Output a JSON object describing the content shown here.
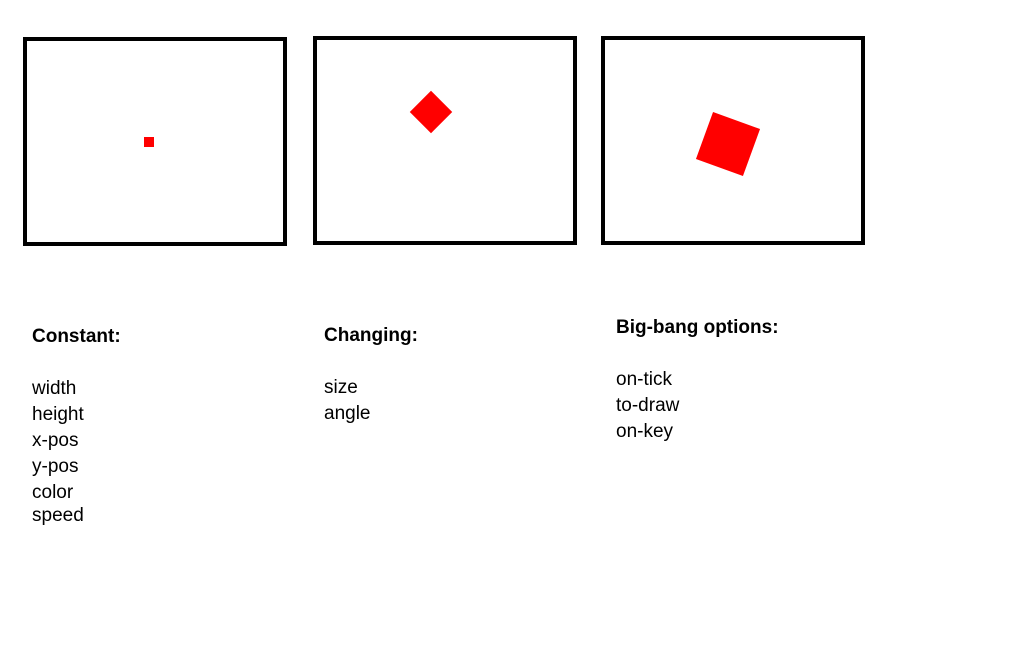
{
  "frames": [
    {
      "shape_color": "#ff0000",
      "rotation_deg": 0
    },
    {
      "shape_color": "#ff0000",
      "rotation_deg": 45
    },
    {
      "shape_color": "#ff0000",
      "rotation_deg": 20
    }
  ],
  "columns": {
    "constant": {
      "title": "Constant:",
      "items": [
        "width",
        "height",
        "x-pos",
        "y-pos",
        "color",
        "speed"
      ]
    },
    "changing": {
      "title": "Changing:",
      "items": [
        "size",
        "angle"
      ]
    },
    "bigbang": {
      "title": "Big-bang options:",
      "items": [
        "on-tick",
        "to-draw",
        "on-key"
      ]
    }
  }
}
